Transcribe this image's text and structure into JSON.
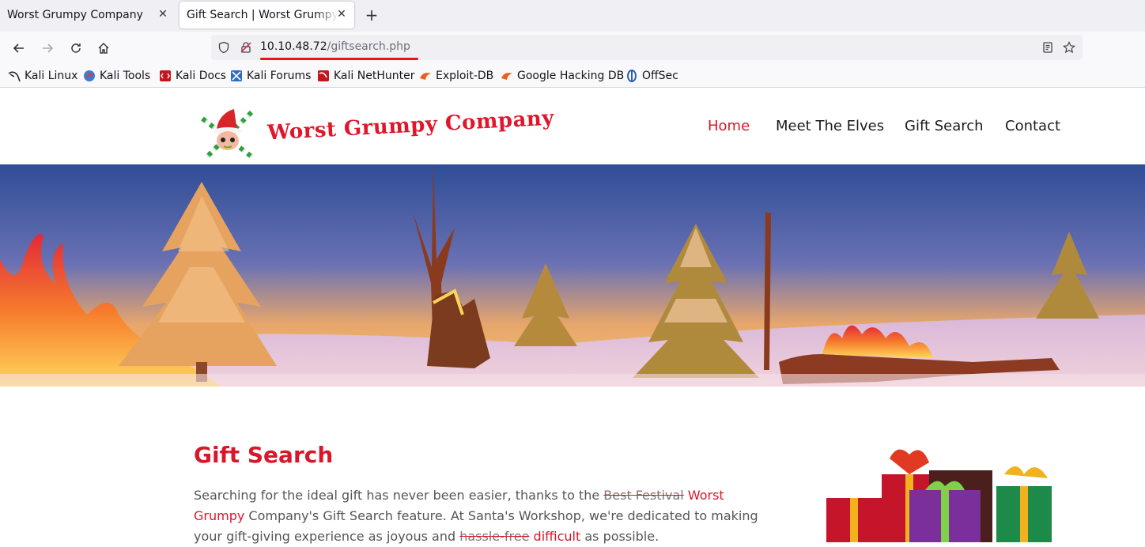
{
  "browser": {
    "tabs": [
      {
        "title": "Worst Grumpy Company",
        "active": false
      },
      {
        "title": "Gift Search | Worst Grumpy Company",
        "active": true
      }
    ],
    "url_host": "10.10.48.72",
    "url_path": "/giftsearch.php",
    "bookmarks": [
      "Kali Linux",
      "Kali Tools",
      "Kali Docs",
      "Kali Forums",
      "Kali NetHunter",
      "Exploit-DB",
      "Google Hacking DB",
      "OffSec"
    ]
  },
  "site": {
    "brand": "Worst Grumpy Company",
    "nav": [
      "Home",
      "Meet The Elves",
      "Gift Search",
      "Contact"
    ],
    "active_nav": "Home"
  },
  "content": {
    "title": "Gift Search",
    "p_part1": "Searching for the ideal gift has never been easier, thanks to the ",
    "strike1": "Best Festival",
    "red1": "Worst Grumpy",
    "p_part2": " Company's Gift Search feature. At Santa's Workshop, we're dedicated to making your gift-giving experience as joyous and ",
    "strike2": "hassle-free",
    "red2": "difficult",
    "p_part3": " as possible."
  },
  "colors": {
    "accent": "#e0162b",
    "chrome": "#f0f0f4"
  }
}
